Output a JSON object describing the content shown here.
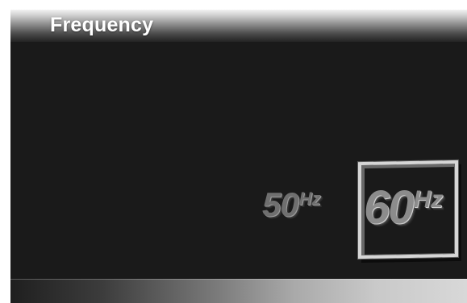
{
  "header": {
    "title": "Frequency"
  },
  "frequency_options": [
    {
      "number": "50",
      "unit": "Hz",
      "selected": false
    },
    {
      "number": "60",
      "unit": "Hz",
      "selected": true
    }
  ],
  "colors": {
    "background": "#1b1b1b",
    "title_text": "#ffffff",
    "selection_frame": "#d6d6d6",
    "option_text": "#8c8c8c"
  }
}
